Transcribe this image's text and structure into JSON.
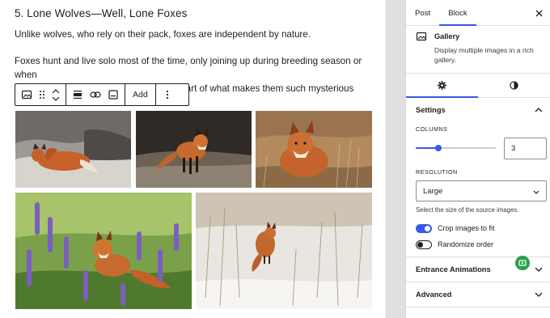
{
  "editor": {
    "heading": "5. Lone Wolves—Well, Lone Foxes",
    "paragraph1": "Unlike wolves, who rely on their pack, foxes are independent by nature.",
    "paragraph2_line1": "Foxes hunt and live solo most of the time, only joining up during breeding season or when",
    "paragraph2_line2": "raising their kits. This solitary lifestyle is part of what makes them such mysterious",
    "toolbar": {
      "add_label": "Add",
      "icons": [
        "gallery-icon",
        "drag-handle-icon",
        "move-up-icon",
        "move-down-icon",
        "align-icon",
        "link-icon",
        "caption-icon",
        "more-options-icon"
      ]
    },
    "images": [
      "fox-sleeping-on-rocks",
      "fox-standing-on-ground",
      "fox-in-dry-grass",
      "fox-in-purple-lupine-flowers",
      "fox-jumping-in-snow"
    ]
  },
  "sidebar": {
    "tabs": [
      "Post",
      "Block"
    ],
    "active_tab": "Block",
    "block": {
      "title": "Gallery",
      "description": "Display multiple images in a rich gallery."
    },
    "settings": {
      "title": "Settings",
      "columns_label": "COLUMNS",
      "columns_value": "3",
      "columns_max": 8,
      "resolution_label": "RESOLUTION",
      "resolution_value": "Large",
      "resolution_help": "Select the size of the source images.",
      "crop_label": "Crop images to fit",
      "crop_on": true,
      "randomize_label": "Randomize order",
      "randomize_on": false
    },
    "panels": [
      "Entrance Animations",
      "Advanced"
    ]
  },
  "colors": {
    "accent": "#3858e9",
    "badge": "#2aa04a"
  }
}
